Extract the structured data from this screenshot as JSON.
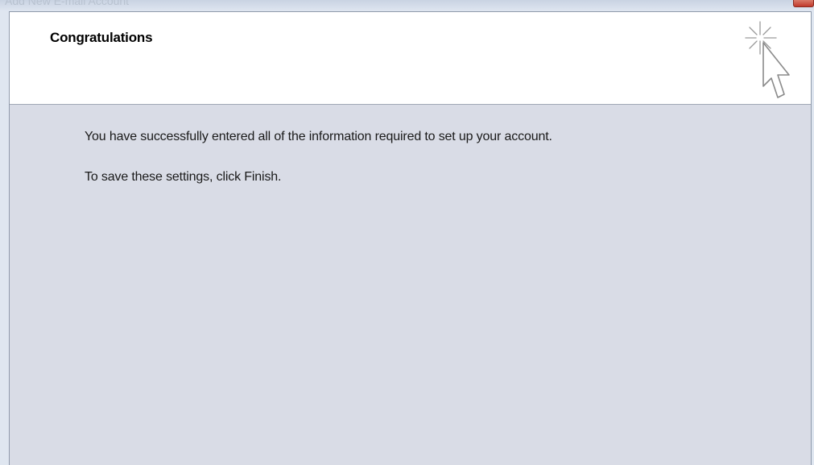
{
  "window": {
    "title": "Add New E-mail Account"
  },
  "header": {
    "title": "Congratulations",
    "icon": "wizard-cursor-icon"
  },
  "content": {
    "line1": "You have successfully entered all of the information required to set up your account.",
    "line2": "To save these settings, click Finish."
  },
  "colors": {
    "content_bg": "#d9dce6",
    "header_bg": "#ffffff",
    "close_button": "#c0392b"
  }
}
